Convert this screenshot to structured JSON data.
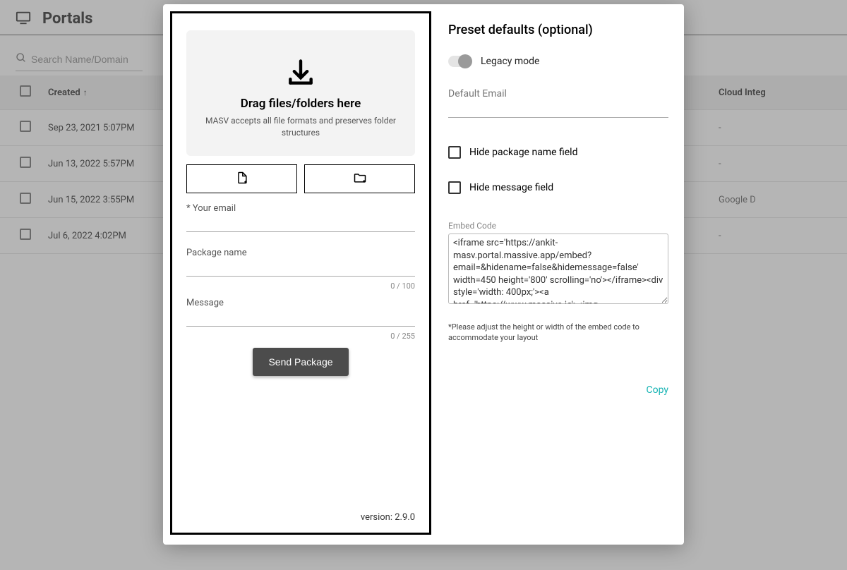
{
  "header": {
    "title": "Portals"
  },
  "search": {
    "placeholder": "Search Name/Domain"
  },
  "table": {
    "headers": {
      "created": "Created",
      "cloud": "Cloud Integ"
    },
    "rows": [
      {
        "created": "Sep 23, 2021 5:07PM",
        "cloud": "-"
      },
      {
        "created": "Jun 13, 2022 5:57PM",
        "cloud": "-"
      },
      {
        "created": "Jun 15, 2022 3:55PM",
        "cloud": "Google D"
      },
      {
        "created": "Jul 6, 2022 4:02PM",
        "cloud": "-"
      }
    ]
  },
  "upload": {
    "drop_title": "Drag files/folders here",
    "drop_sub": "MASV accepts all file formats and preserves folder structures",
    "email_label": "* Your email",
    "package_label": "Package name",
    "package_counter": "0 / 100",
    "message_label": "Message",
    "message_counter": "0 / 255",
    "send_label": "Send Package",
    "version": "version: 2.9.0"
  },
  "presets": {
    "title": "Preset defaults (optional)",
    "legacy_label": "Legacy mode",
    "default_email_label": "Default Email",
    "hide_pkg_label": "Hide package name field",
    "hide_msg_label": "Hide message field",
    "embed_label": "Embed Code",
    "embed_code": "<iframe src='https://ankit-masv.portal.massive.app/embed?email=&hidename=false&hidemessage=false' width=450 height='800' scrolling='no'></iframe><div style='width: 400px;'><a href='https://www.massive.io'><img",
    "note": "*Please adjust the height or width of the embed code to accommodate your layout",
    "copy_label": "Copy"
  }
}
